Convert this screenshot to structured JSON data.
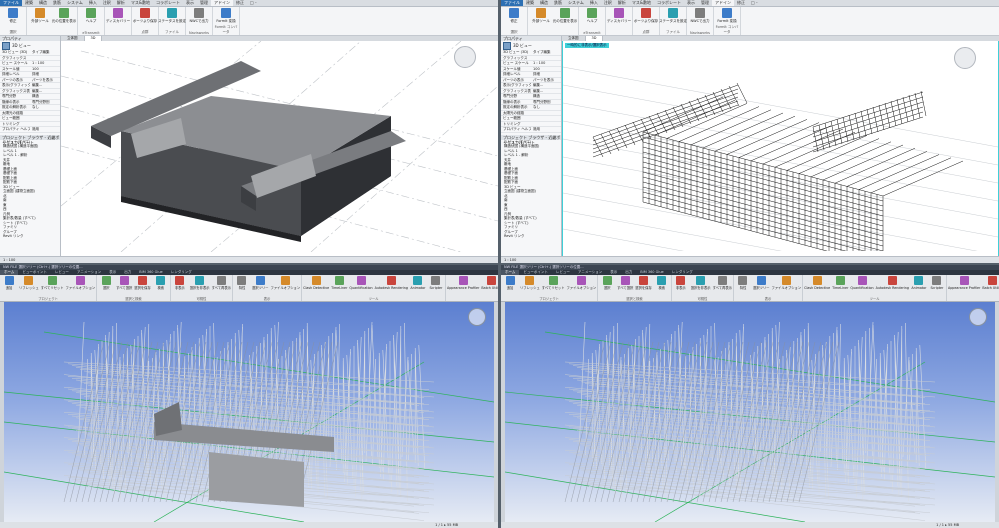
{
  "revit": {
    "tabs": [
      "ファイル",
      "建築",
      "構造",
      "鉄筋",
      "システム",
      "挿入",
      "注釈",
      "解析",
      "マス&敷地",
      "コラボレート",
      "表示",
      "管理",
      "アドイン",
      "修正",
      "□ -"
    ],
    "active_tab": "アドイン",
    "ribbon_groups": [
      {
        "label": "選択",
        "buttons": [
          "修正"
        ]
      },
      {
        "label": "",
        "buttons": [
          "外部ツール",
          "元の位置を表示"
        ]
      },
      {
        "label": "eTransmit",
        "buttons": [
          "ヘルプ"
        ]
      },
      {
        "label": "",
        "buttons": [
          "ディスカバリー"
        ]
      },
      {
        "label": "点群",
        "buttons": [
          "ポーツより保存"
        ]
      },
      {
        "label": "ファイル",
        "buttons": [
          "ステータスを設定"
        ]
      },
      {
        "label": "Navisworks",
        "buttons": [
          "NWCで出力"
        ]
      },
      {
        "label": "FormIt コンバータ",
        "buttons": [
          "FormIt 変換"
        ]
      }
    ],
    "properties": {
      "header": "プロパティ",
      "type": "3D ビュー",
      "rows": [
        [
          "3D ビュー (3D)",
          "タイプ編集"
        ],
        [
          "グラフィックス",
          ""
        ],
        [
          "ビュー スケール",
          "1 : 100"
        ],
        [
          "スケール値",
          "100"
        ],
        [
          "詳細レベル",
          "詳細"
        ],
        [
          "パーツの表示",
          "パーツを表示"
        ],
        [
          "表示/グラフィックス",
          "編集..."
        ],
        [
          "グラフィックス表示",
          "編集..."
        ],
        [
          "専門分野",
          "構造"
        ],
        [
          "隠線の表示",
          "専門分野別"
        ],
        [
          "既定の解析表示",
          "なし"
        ],
        [
          "太陽光の経路",
          ""
        ],
        [
          "ビュー範囲",
          ""
        ],
        [
          "トリミング",
          ""
        ],
        [
          "プロパティ ヘルプ",
          "適用"
        ]
      ]
    },
    "browser": {
      "header": "プロジェクト ブラウザ - 近畿ボックスカルバート",
      "items": [
        "ビュー(すべて)",
        "構造伏図 (構造平面図)",
        "レベル 1",
        "レベル 1 - 解析",
        "天井",
        "敷地",
        "基礎上面",
        "基礎下面",
        "配筋上面",
        "配筋下面",
        "3D ビュー",
        "立面図 (建物立面図)",
        "北",
        "南",
        "東",
        "西",
        "凡例",
        "集計表/数量 (すべて)",
        "シート (すべて)",
        "ファミリ",
        "グループ",
        "Revit リンク"
      ]
    },
    "view_tabs": [
      "立体図",
      "3D"
    ],
    "left_view_label": "3D",
    "right_view_label": "3D",
    "right_highlight_label": "一時的に非表示/選択表示",
    "status": "1 : 100",
    "highlight_color": "#3fd0d8"
  },
  "navisworks": {
    "title": "NW FILE  選択ツリー (Ctrl+.)  選択ツリーの位置...",
    "tabs": [
      "ホーム",
      "ビューポイント",
      "レビュー",
      "アニメーション",
      "表示",
      "出力",
      "BIM 360 Glue",
      "レンダリング"
    ],
    "active_tab": "ホーム",
    "ribbon": [
      {
        "label": "プロジェクト",
        "buttons": [
          "追加",
          "リフレッシュ",
          "すべてリセット",
          "ファイルオプション"
        ]
      },
      {
        "label": "選択と検索",
        "buttons": [
          "選択",
          "すべて選択",
          "選択を保存",
          "検索"
        ]
      },
      {
        "label": "可視性",
        "buttons": [
          "非表示",
          "選択を非表示",
          "すべて再表示"
        ]
      },
      {
        "label": "表示",
        "buttons": [
          "特性",
          "選択ツリー",
          "ファイルオプション"
        ]
      },
      {
        "label": "ツール",
        "buttons": [
          "Clash Detective",
          "TimeLiner",
          "Quantification",
          "Autodesk Rendering",
          "Animator",
          "Scripter"
        ]
      },
      {
        "label": "",
        "buttons": [
          "Appearance Profiler",
          "Batch Utility",
          "比較"
        ]
      },
      {
        "label": "",
        "buttons": [
          "DataTools",
          "App Manager"
        ]
      }
    ],
    "status_left": "1 / 1",
    "status_right": "1 / 1 ▸ 55 MB"
  },
  "colors": {
    "revit_ribbon": "#f4f5f7",
    "nav_sky_top": "#5c7fd0",
    "nav_sky_bottom": "#e6ebf4",
    "concrete_dark": "#5a5c60",
    "concrete_light": "#a5a7aa",
    "grid_green": "#2db35a"
  }
}
